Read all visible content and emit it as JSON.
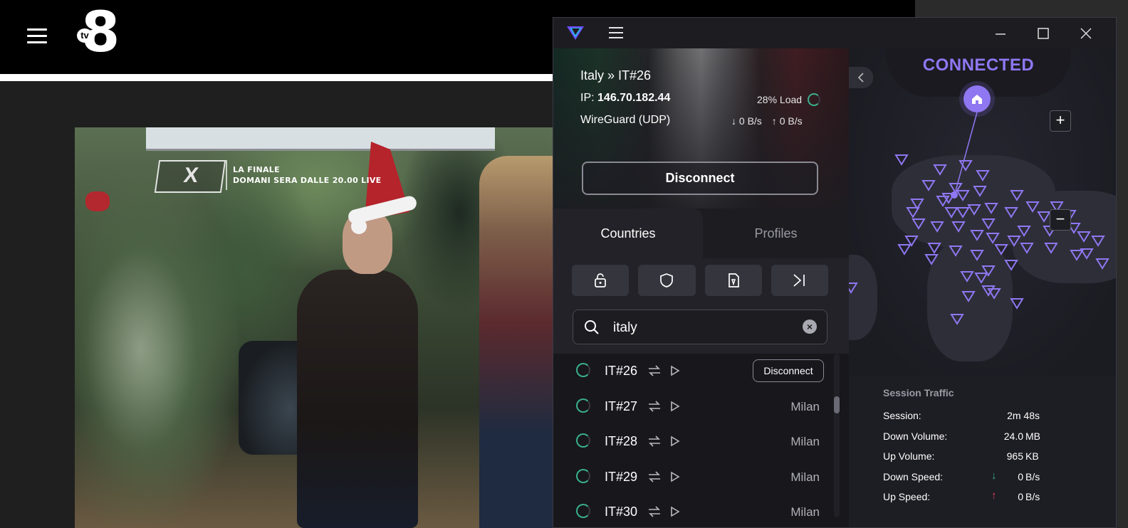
{
  "site": {
    "logo_text": "8",
    "logo_tv": "tv"
  },
  "video": {
    "overlay_logo": "X",
    "overlay_line1": "LA FINALE",
    "overlay_line2": "DOMANI SERA DALLE 20.00 LIVE"
  },
  "vpn": {
    "colors": {
      "accent": "#8f77f2",
      "load_ring": "#3ab08e",
      "down_arrow": "#3ab08e",
      "up_arrow": "#e0455a"
    },
    "connection": {
      "server": "Italy » IT#26",
      "ip_label": "IP:",
      "ip": "146.70.182.44",
      "protocol": "WireGuard (UDP)",
      "load": "28% Load",
      "download": "0 B/s",
      "upload": "0 B/s",
      "disconnect_label": "Disconnect"
    },
    "tabs": {
      "countries": "Countries",
      "profiles": "Profiles"
    },
    "filters": [
      "lock-icon",
      "shield-icon",
      "sim-card-icon",
      "arrow-to-right-icon"
    ],
    "search": {
      "value": "italy",
      "placeholder": ""
    },
    "servers": [
      {
        "name": "IT#26",
        "city": "",
        "action": "Disconnect"
      },
      {
        "name": "IT#27",
        "city": "Milan"
      },
      {
        "name": "IT#28",
        "city": "Milan"
      },
      {
        "name": "IT#29",
        "city": "Milan"
      },
      {
        "name": "IT#30",
        "city": "Milan"
      }
    ],
    "map": {
      "status": "CONNECTED",
      "zoom_in": "+",
      "zoom_out": "−"
    },
    "traffic": {
      "title": "Session Traffic",
      "session_label": "Session:",
      "session_value": "2m 48s",
      "down_volume_label": "Down Volume:",
      "down_volume_value": "24.0",
      "down_volume_unit": "MB",
      "up_volume_label": "Up Volume:",
      "up_volume_value": "965",
      "up_volume_unit": "KB",
      "down_speed_label": "Down Speed:",
      "down_speed_value": "0",
      "down_speed_unit": "B/s",
      "up_speed_label": "Up Speed:",
      "up_speed_value": "0",
      "up_speed_unit": "B/s"
    }
  }
}
